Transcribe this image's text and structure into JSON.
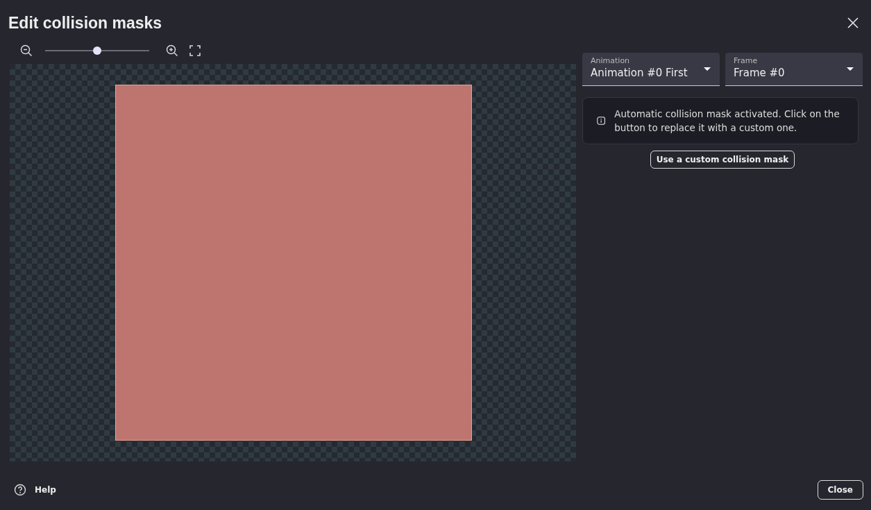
{
  "dialog": {
    "title": "Edit collision masks"
  },
  "zoom": {
    "level": 0.5
  },
  "selectors": [
    {
      "label": "Animation",
      "value": "Animation #0 First"
    },
    {
      "label": "Frame",
      "value": "Frame #0"
    }
  ],
  "notice": {
    "text": "Automatic collision mask activated. Click on the button to replace it with a custom one."
  },
  "custom_mask_button": "Use a custom collision mask",
  "footer": {
    "help": "Help",
    "close": "Close"
  }
}
